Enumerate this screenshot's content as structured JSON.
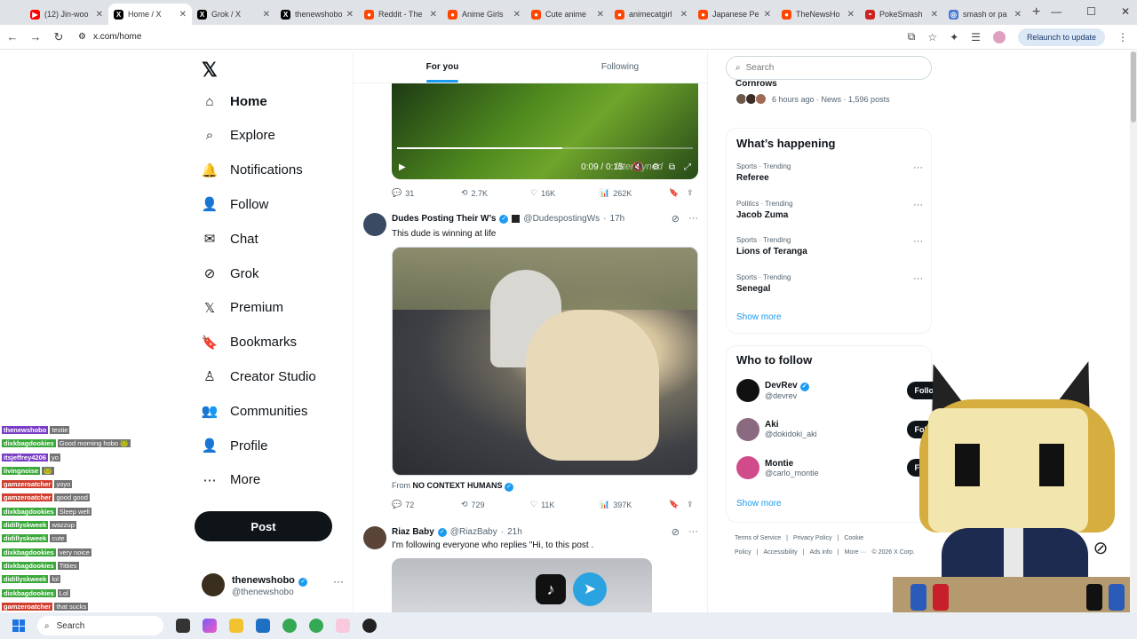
{
  "browser": {
    "tabs": [
      {
        "label": "(12) Jin-woo",
        "icon": "youtube-icon",
        "color": "#ff0000"
      },
      {
        "label": "Home / X",
        "icon": "x-icon",
        "color": "#000000",
        "active": true
      },
      {
        "label": "Grok / X",
        "icon": "x-icon",
        "color": "#000000"
      },
      {
        "label": "thenewshobo",
        "icon": "x-icon",
        "color": "#000000"
      },
      {
        "label": "Reddit - The",
        "icon": "reddit-icon",
        "color": "#ff4500"
      },
      {
        "label": "Anime Girls",
        "icon": "reddit-icon",
        "color": "#ff4500"
      },
      {
        "label": "Cute anime",
        "icon": "reddit-icon",
        "color": "#ff4500"
      },
      {
        "label": "animecatgirl",
        "icon": "reddit-icon",
        "color": "#ff4500"
      },
      {
        "label": "Japanese Pe",
        "icon": "reddit-icon",
        "color": "#ff4500"
      },
      {
        "label": "TheNewsHo",
        "icon": "reddit-icon",
        "color": "#ff4500"
      },
      {
        "label": "PokeSmash",
        "icon": "pokeball-icon",
        "color": "#cc2222"
      },
      {
        "label": "smash or pa",
        "icon": "globe-icon",
        "color": "#4a7bd0"
      }
    ],
    "url": "x.com/home",
    "relaunch_label": "Relaunch to update"
  },
  "nav": {
    "items": [
      {
        "label": "Home",
        "icon": "home-icon",
        "bold": true
      },
      {
        "label": "Explore",
        "icon": "search-icon"
      },
      {
        "label": "Notifications",
        "icon": "bell-icon"
      },
      {
        "label": "Follow",
        "icon": "person-plus-icon"
      },
      {
        "label": "Chat",
        "icon": "mail-icon"
      },
      {
        "label": "Grok",
        "icon": "grok-icon"
      },
      {
        "label": "Premium",
        "icon": "x-icon"
      },
      {
        "label": "Bookmarks",
        "icon": "bookmark-icon"
      },
      {
        "label": "Creator Studio",
        "icon": "creator-icon"
      },
      {
        "label": "Communities",
        "icon": "communities-icon"
      },
      {
        "label": "Profile",
        "icon": "profile-icon"
      },
      {
        "label": "More",
        "icon": "more-circle-icon"
      }
    ],
    "post_label": "Post",
    "account": {
      "name": "thenewshobo",
      "handle": "@thenewshobo"
    }
  },
  "feed": {
    "tabs": [
      "For you",
      "Following"
    ],
    "video": {
      "time": "0:09 / 0:15",
      "watermark": "litteralyned",
      "progress": 0.56
    },
    "tweet1_actions": {
      "replies": "31",
      "reposts": "2.7K",
      "likes": "16K",
      "views": "262K"
    },
    "tweet2": {
      "name": "Dudes Posting Their W’s",
      "handle": "@DudespostingWs",
      "time": "17h",
      "text": "This dude is winning at life",
      "credit_prefix": "From",
      "credit_source": "NO CONTEXT HUMANS",
      "actions": {
        "replies": "72",
        "reposts": "729",
        "likes": "11K",
        "views": "397K"
      }
    },
    "tweet3": {
      "name": "Riaz Baby",
      "handle": "@RiazBaby",
      "time": "21h",
      "text": "I'm following everyone who replies \"Hi, to this post ."
    }
  },
  "sidebar": {
    "search_placeholder": "Search",
    "top_trend": {
      "title": "Cornrows",
      "meta": "6 hours ago · News · 1,596 posts"
    },
    "happening_title": "What’s happening",
    "trends": [
      {
        "category": "Sports · Trending",
        "topic": "Referee"
      },
      {
        "category": "Politics · Trending",
        "topic": "Jacob Zuma"
      },
      {
        "category": "Sports · Trending",
        "topic": "Lions of Teranga"
      },
      {
        "category": "Sports · Trending",
        "topic": "Senegal"
      }
    ],
    "show_more": "Show more",
    "wtf_title": "Who to follow",
    "wtf": [
      {
        "name": "DevRev",
        "handle": "@devrev",
        "verified": true,
        "color": "#111111"
      },
      {
        "name": "Aki",
        "handle": "@dokidoki_aki",
        "verified": false,
        "color": "#8a6a80"
      },
      {
        "name": "Montie",
        "handle": "@carlo_montie",
        "verified": false,
        "color": "#d14a8a"
      }
    ],
    "follow_label": "Follow",
    "footer": [
      "Terms of Service",
      "|",
      "Privacy Policy",
      "|",
      "Cookie Policy",
      "|",
      "Accessibility",
      "|",
      "Ads info",
      "|",
      "More ···",
      "© 2026 X Corp."
    ]
  },
  "chat": [
    {
      "user": "thenewshobo",
      "msg": "testie",
      "color": "#7a3ec7"
    },
    {
      "user": "dixkbagdookies",
      "msg": "Good morning hobo 🐸",
      "color": "#3aa83a"
    },
    {
      "user": "itsjeffrey4206",
      "msg": "yo",
      "color": "#7a3ec7"
    },
    {
      "user": "livingnoise",
      "msg": "🐸",
      "color": "#3aa83a"
    },
    {
      "user": "gamzeroatcher",
      "msg": "yoyo",
      "color": "#d04030"
    },
    {
      "user": "gamzeroatcher",
      "msg": "good good",
      "color": "#d04030"
    },
    {
      "user": "dixkbagdookies",
      "msg": "Sleep well",
      "color": "#3aa83a"
    },
    {
      "user": "didillyskweek",
      "msg": "wazzup",
      "color": "#3aa83a"
    },
    {
      "user": "didillyskweek",
      "msg": "cute",
      "color": "#3aa83a"
    },
    {
      "user": "dixkbagdookies",
      "msg": "very noice",
      "color": "#3aa83a"
    },
    {
      "user": "dixkbagdookies",
      "msg": "Titties",
      "color": "#3aa83a"
    },
    {
      "user": "didillyskweek",
      "msg": "lol",
      "color": "#3aa83a"
    },
    {
      "user": "dixkbagdookies",
      "msg": "Lol",
      "color": "#3aa83a"
    },
    {
      "user": "gamzeroatcher",
      "msg": "that sucks",
      "color": "#d04030"
    }
  ],
  "taskbar": {
    "search_label": "Search"
  }
}
